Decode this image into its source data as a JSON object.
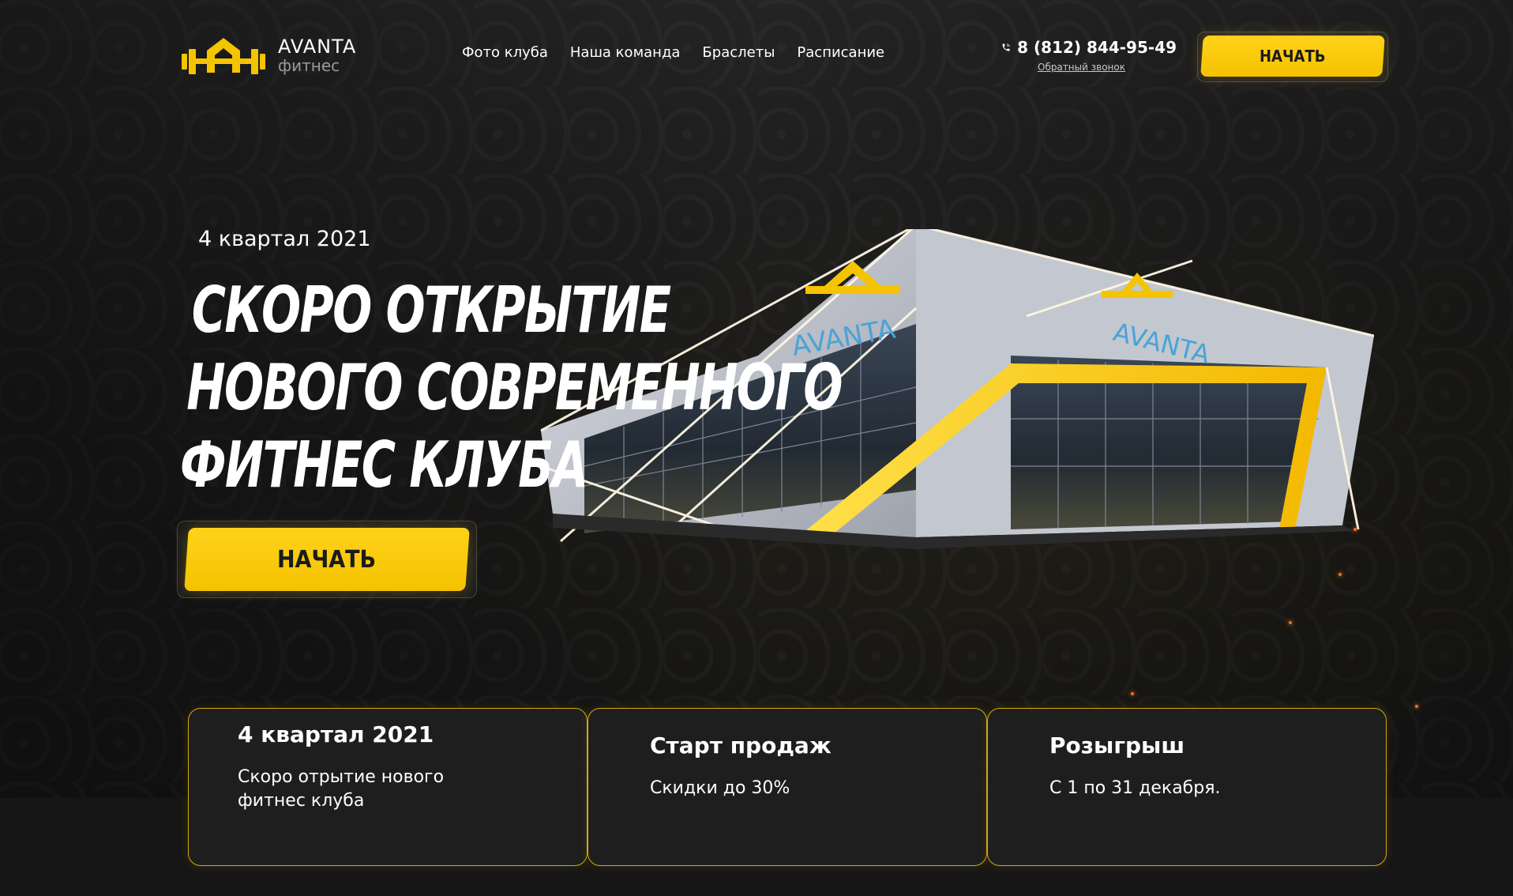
{
  "brand": {
    "name": "AVANTA",
    "subtitle": "фитнес",
    "building_sign": "AVANTA",
    "accent_color": "#f5c400"
  },
  "nav": {
    "items": [
      {
        "label": "Фото клуба"
      },
      {
        "label": "Наша команда"
      },
      {
        "label": "Браслеты"
      },
      {
        "label": "Расписание"
      }
    ]
  },
  "contact": {
    "phone": "8 (812) 844-95-49",
    "callback_label": "Обратный звонок",
    "phone_icon": "phone-icon"
  },
  "header": {
    "cta_label": "НАЧАТЬ"
  },
  "hero": {
    "date": "4 квартал 2021",
    "title_lines": [
      "СКОРО ОТКРЫТИЕ",
      "НОВОГО СОВРЕМЕННОГО",
      "ФИТНЕС КЛУБА"
    ],
    "cta_label": "НАЧАТЬ"
  },
  "cards": [
    {
      "title": "4 квартал 2021",
      "text": "Скоро отрытие нового фитнес клуба"
    },
    {
      "title": "Старт продаж",
      "text": "Скидки до 30%"
    },
    {
      "title": "Розыгрыш",
      "text": "С 1 по 31 декабря."
    }
  ]
}
